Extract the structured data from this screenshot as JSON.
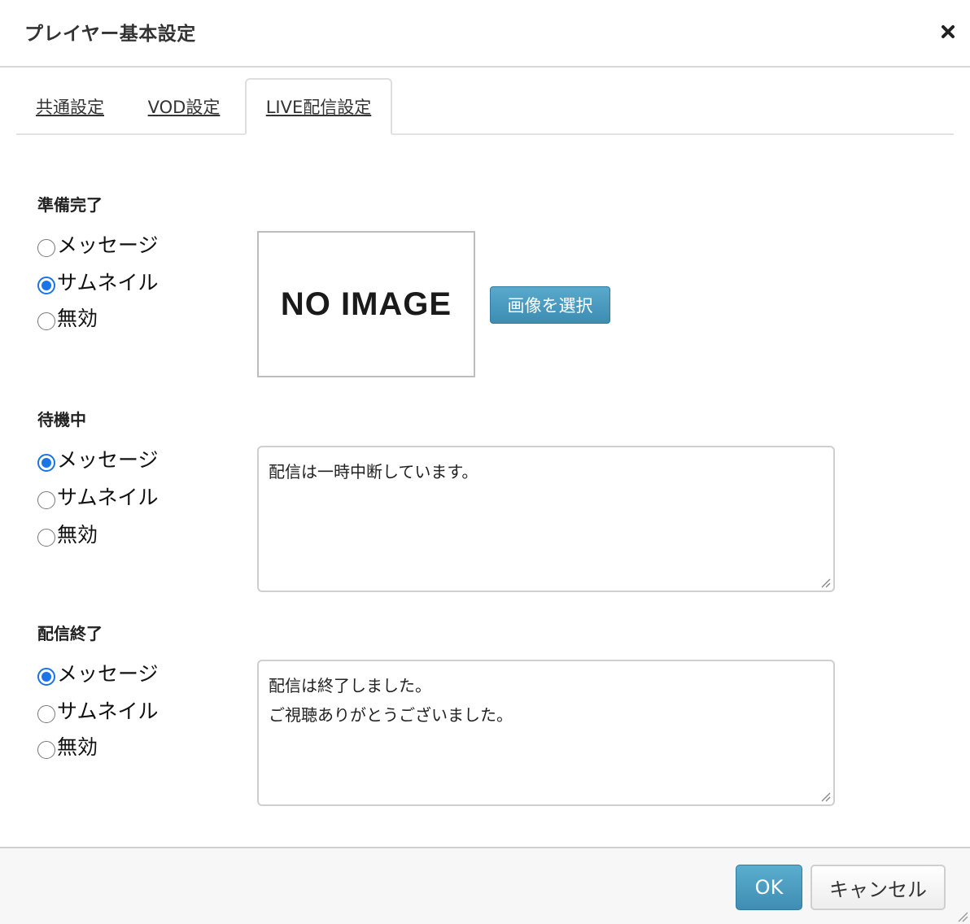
{
  "dialog": {
    "title": "プレイヤー基本設定",
    "close_icon": "close-icon"
  },
  "tabs": [
    {
      "label": "共通設定",
      "active": false
    },
    {
      "label": "VOD設定",
      "active": false
    },
    {
      "label": "LIVE配信設定",
      "active": true
    }
  ],
  "sections": {
    "ready": {
      "label": "準備完了",
      "options": [
        "メッセージ",
        "サムネイル",
        "無効"
      ],
      "selected": "サムネイル",
      "thumbnail_text": "NO IMAGE",
      "select_image_label": "画像を選択"
    },
    "standby": {
      "label": "待機中",
      "options": [
        "メッセージ",
        "サムネイル",
        "無効"
      ],
      "selected": "メッセージ",
      "message_lines": [
        "配信は一時中断しています。"
      ]
    },
    "ended": {
      "label": "配信終了",
      "options": [
        "メッセージ",
        "サムネイル",
        "無効"
      ],
      "selected": "メッセージ",
      "message_lines": [
        "配信は終了しました。",
        "ご視聴ありがとうございました。"
      ]
    }
  },
  "footer": {
    "ok_label": "OK",
    "cancel_label": "キャンセル"
  },
  "colors": {
    "accent": "#1a73e8",
    "button_blue": "#4a9cc2"
  }
}
